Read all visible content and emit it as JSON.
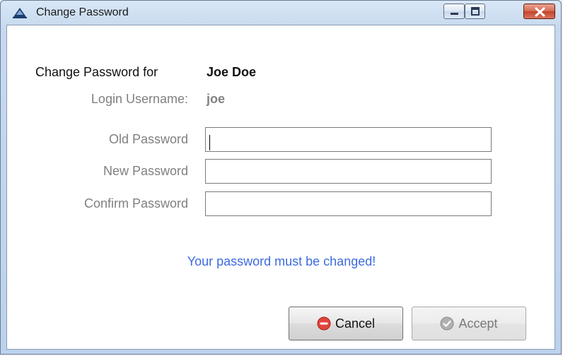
{
  "window": {
    "title": "Change Password",
    "icons": {
      "app": "app-pyramid-icon",
      "minimize": "minimize-icon",
      "maximize": "maximize-icon",
      "close": "close-icon"
    }
  },
  "form": {
    "header_label": "Change Password for",
    "user_fullname": "Joe Doe",
    "login_label": "Login Username:",
    "login_value": "joe",
    "old_password_label": "Old Password",
    "new_password_label": "New Password",
    "confirm_password_label": "Confirm Password",
    "old_password_value": "",
    "new_password_value": "",
    "confirm_password_value": "",
    "message": "Your password must be changed!"
  },
  "buttons": {
    "cancel_label": "Cancel",
    "cancel_icon": "cancel-red-circle-icon",
    "accept_label": "Accept",
    "accept_icon": "accept-check-circle-icon"
  },
  "colors": {
    "message": "#3d6bde",
    "cancel_icon": "#e0443a",
    "accept_icon_disabled": "#9c9c9c"
  }
}
